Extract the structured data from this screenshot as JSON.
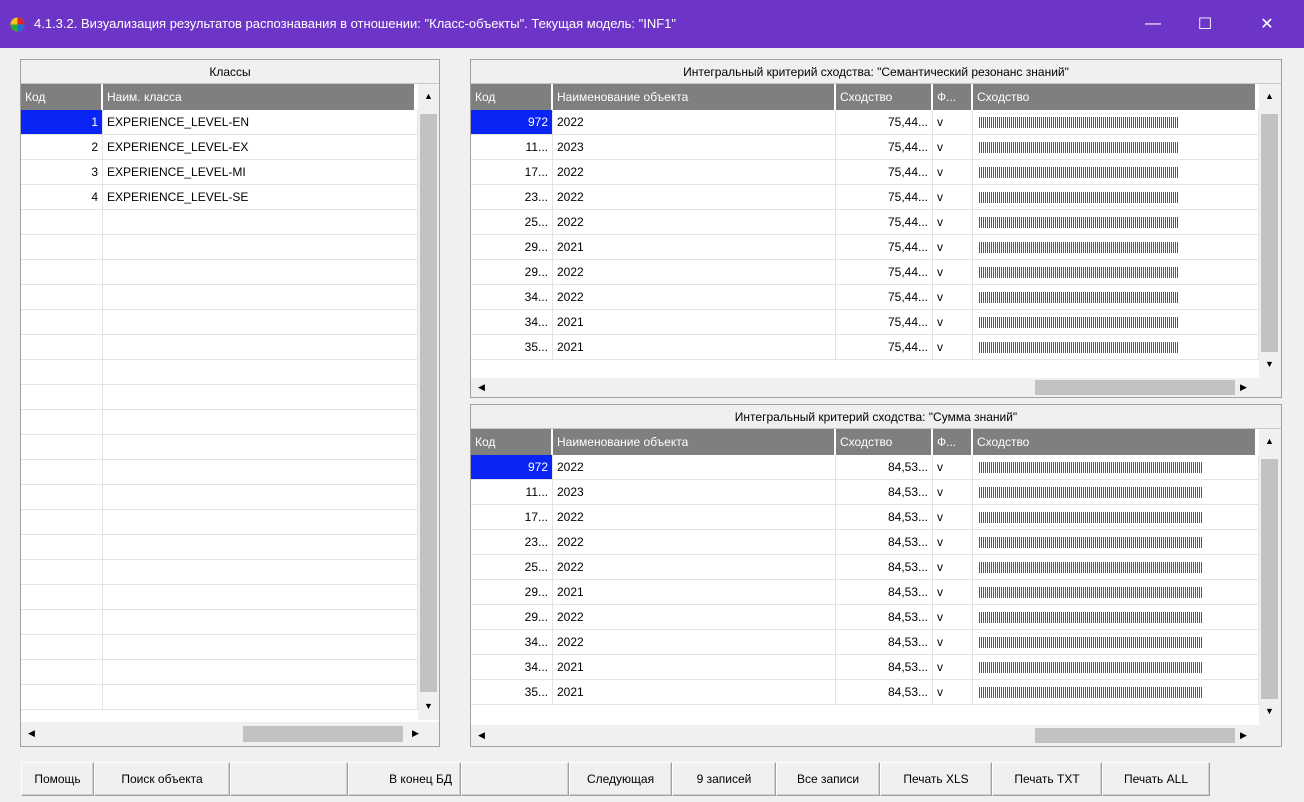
{
  "window": {
    "title": "4.1.3.2. Визуализация результатов распознавания в отношении: \"Класс-объекты\". Текущая модель: \"INF1\"",
    "minimize_glyph": "—",
    "maximize_glyph": "☐",
    "close_glyph": "✕"
  },
  "classes_panel": {
    "caption": "Классы",
    "columns": [
      "Код",
      "Наим. класса"
    ],
    "rows": [
      {
        "code": "1",
        "name": "EXPERIENCE_LEVEL-EN"
      },
      {
        "code": "2",
        "name": "EXPERIENCE_LEVEL-EX"
      },
      {
        "code": "3",
        "name": "EXPERIENCE_LEVEL-MI"
      },
      {
        "code": "4",
        "name": "EXPERIENCE_LEVEL-SE"
      }
    ]
  },
  "semantic_panel": {
    "caption": "Интегральный критерий сходства: \"Семантический резонанс знаний\"",
    "columns": [
      "Код",
      "Наименование объекта",
      "Сходство",
      "Ф...",
      "Сходство"
    ],
    "rows": [
      {
        "code": "972",
        "name": "2022",
        "similarity": "75,44...",
        "flag": "v",
        "bar_fraction": 0.75
      },
      {
        "code": "11...",
        "name": "2023",
        "similarity": "75,44...",
        "flag": "v",
        "bar_fraction": 0.75
      },
      {
        "code": "17...",
        "name": "2022",
        "similarity": "75,44...",
        "flag": "v",
        "bar_fraction": 0.75
      },
      {
        "code": "23...",
        "name": "2022",
        "similarity": "75,44...",
        "flag": "v",
        "bar_fraction": 0.75
      },
      {
        "code": "25...",
        "name": "2022",
        "similarity": "75,44...",
        "flag": "v",
        "bar_fraction": 0.75
      },
      {
        "code": "29...",
        "name": "2021",
        "similarity": "75,44...",
        "flag": "v",
        "bar_fraction": 0.75
      },
      {
        "code": "29...",
        "name": "2022",
        "similarity": "75,44...",
        "flag": "v",
        "bar_fraction": 0.75
      },
      {
        "code": "34...",
        "name": "2022",
        "similarity": "75,44...",
        "flag": "v",
        "bar_fraction": 0.75
      },
      {
        "code": "34...",
        "name": "2021",
        "similarity": "75,44...",
        "flag": "v",
        "bar_fraction": 0.75
      },
      {
        "code": "35...",
        "name": "2021",
        "similarity": "75,44...",
        "flag": "v",
        "bar_fraction": 0.75
      }
    ]
  },
  "sum_panel": {
    "caption": "Интегральный критерий сходства: \"Сумма знаний\"",
    "columns": [
      "Код",
      "Наименование объекта",
      "Сходство",
      "Ф...",
      "Сходство"
    ],
    "rows": [
      {
        "code": "972",
        "name": "2022",
        "similarity": "84,53...",
        "flag": "v",
        "bar_fraction": 0.845
      },
      {
        "code": "11...",
        "name": "2023",
        "similarity": "84,53...",
        "flag": "v",
        "bar_fraction": 0.845
      },
      {
        "code": "17...",
        "name": "2022",
        "similarity": "84,53...",
        "flag": "v",
        "bar_fraction": 0.845
      },
      {
        "code": "23...",
        "name": "2022",
        "similarity": "84,53...",
        "flag": "v",
        "bar_fraction": 0.845
      },
      {
        "code": "25...",
        "name": "2022",
        "similarity": "84,53...",
        "flag": "v",
        "bar_fraction": 0.845
      },
      {
        "code": "29...",
        "name": "2021",
        "similarity": "84,53...",
        "flag": "v",
        "bar_fraction": 0.845
      },
      {
        "code": "29...",
        "name": "2022",
        "similarity": "84,53...",
        "flag": "v",
        "bar_fraction": 0.845
      },
      {
        "code": "34...",
        "name": "2022",
        "similarity": "84,53...",
        "flag": "v",
        "bar_fraction": 0.845
      },
      {
        "code": "34...",
        "name": "2021",
        "similarity": "84,53...",
        "flag": "v",
        "bar_fraction": 0.845
      },
      {
        "code": "35...",
        "name": "2021",
        "similarity": "84,53...",
        "flag": "v",
        "bar_fraction": 0.845
      }
    ]
  },
  "toolbar": {
    "help": "Помощь",
    "find_object": "Поиск объекта",
    "blank1": "",
    "to_end": "В конец БД",
    "blank2": "",
    "next": "Следующая",
    "nine_records": "9 записей",
    "all_records": "Все записи",
    "print_xls": "Печать XLS",
    "print_txt": "Печать TXT",
    "print_all": "Печать ALL"
  },
  "colors": {
    "titlebar": "#6d35c7",
    "selection": "#0a24f5",
    "bar": "#e02020",
    "header": "#7f7f7f"
  },
  "icons": {
    "app": "app-logo-icon",
    "scroll_up": "arrow-up-icon",
    "scroll_down": "arrow-down-icon",
    "scroll_left": "arrow-left-icon",
    "scroll_right": "arrow-right-icon"
  }
}
